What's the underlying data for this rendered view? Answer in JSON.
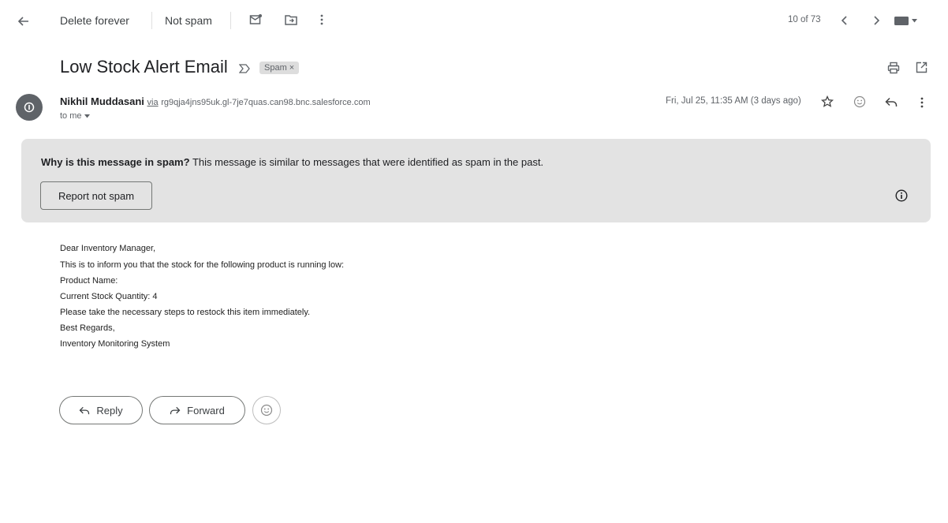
{
  "toolbar": {
    "back_icon": "arrow-left-icon",
    "delete_forever": "Delete forever",
    "not_spam": "Not spam",
    "pagination": "10 of 73"
  },
  "message": {
    "subject": "Low Stock Alert Email",
    "label": "Spam",
    "sender_name": "Nikhil Muddasani",
    "via": "via",
    "sender_domain": "rg9qja4jns95uk.gl-7je7quas.can98.bnc.salesforce.com",
    "to": "to me",
    "date": "Fri, Jul 25, 11:35 AM (3 days ago)"
  },
  "spam_banner": {
    "question": "Why is this message in spam?",
    "explanation": "This message is similar to messages that were identified as spam in the past.",
    "report_button": "Report not spam"
  },
  "body": {
    "lines": [
      "Dear Inventory Manager,",
      "This is to inform you that the stock for the following product is running low:",
      "Product Name:",
      "Current Stock Quantity: 4",
      "Please take the necessary steps to restock this item immediately.",
      "Best Regards,",
      "Inventory Monitoring System"
    ]
  },
  "actions": {
    "reply": "Reply",
    "forward": "Forward"
  },
  "colors": {
    "banner_bg": "#e3e3e3",
    "spam_chip_bg": "#dddddd",
    "avatar_bg": "#5f6368"
  }
}
